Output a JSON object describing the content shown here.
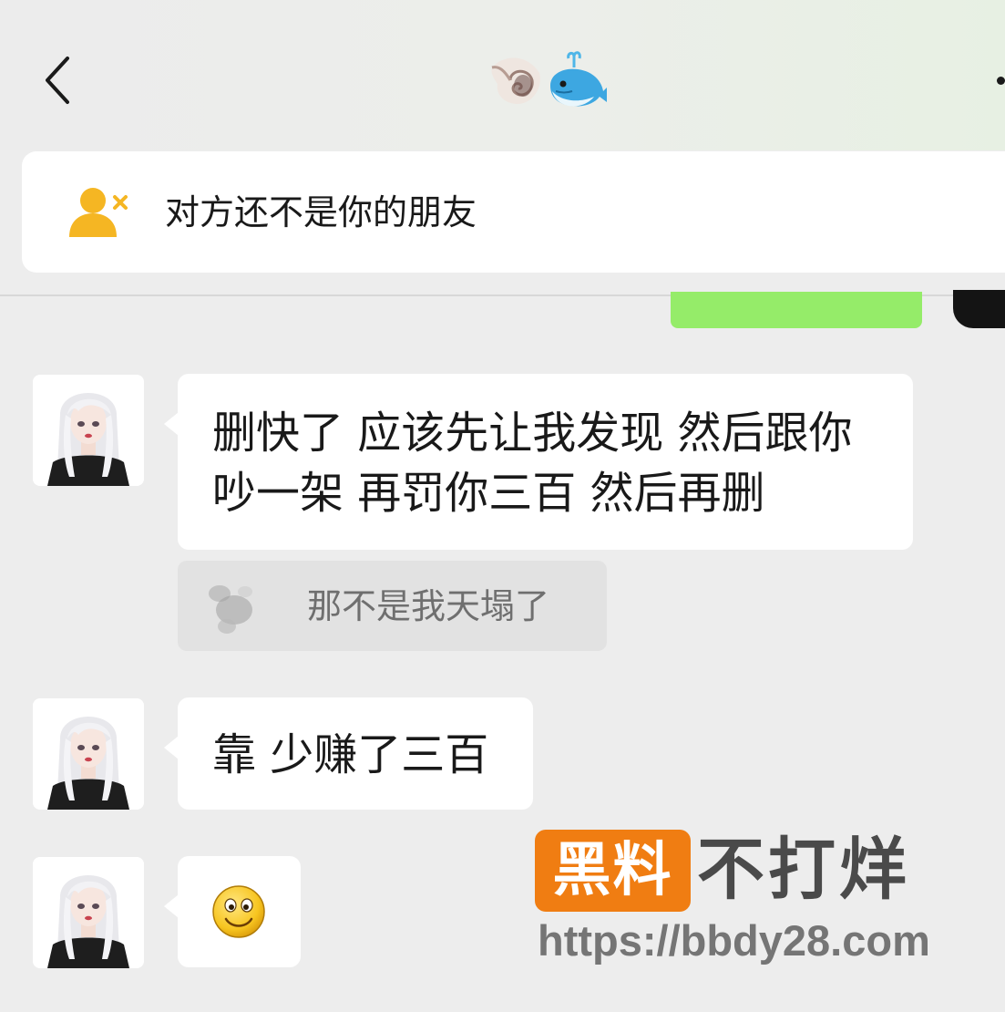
{
  "header": {
    "back_icon": "chevron-left-icon",
    "title_emojis": [
      "spiral-shell",
      "spouting-whale"
    ],
    "more_icon": "more-dots-icon"
  },
  "banner": {
    "icon": "user-removed-icon",
    "icon_color": "#f5b623",
    "text": "对方还不是你的朋友"
  },
  "messages": [
    {
      "direction": "incoming",
      "lines": [
        "删快了 应该先让我发现 然后跟你",
        "吵一架 再罚你三百 然后再删"
      ],
      "quote": {
        "text": "那不是我天塌了"
      }
    },
    {
      "direction": "incoming",
      "lines": [
        "靠 少赚了三百"
      ]
    },
    {
      "direction": "incoming",
      "emoji": "smiley-face"
    }
  ],
  "colors": {
    "background": "#ededed",
    "incoming_bubble": "#ffffff",
    "outgoing_bubble": "#95ec69",
    "quote_background": "#e2e2e2"
  },
  "watermark": {
    "brand_a": "黑料",
    "brand_b": "不打烊",
    "url": "https://bbdy28.com",
    "accent": "#f07d12"
  }
}
